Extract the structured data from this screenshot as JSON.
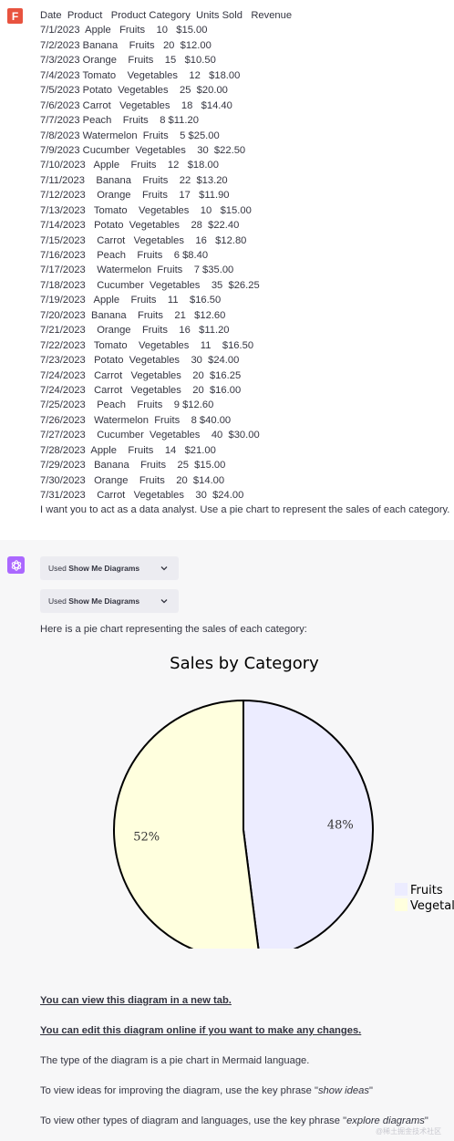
{
  "user": {
    "avatar_letter": "F",
    "avatar_color": "#e8533f",
    "lines": [
      "Date  Product   Product Category  Units Sold   Revenue",
      "7/1/2023  Apple   Fruits    10   $15.00",
      "7/2/2023 Banana    Fruits   20  $12.00",
      "7/3/2023 Orange    Fruits    15   $10.50",
      "7/4/2023 Tomato    Vegetables    12   $18.00",
      "7/5/2023 Potato  Vegetables    25  $20.00",
      "7/6/2023 Carrot   Vegetables    18   $14.40",
      "7/7/2023 Peach    Fruits    8 $11.20",
      "7/8/2023 Watermelon  Fruits    5 $25.00",
      "7/9/2023 Cucumber  Vegetables    30  $22.50",
      "7/10/2023   Apple    Fruits    12   $18.00",
      "7/11/2023    Banana    Fruits    22  $13.20",
      "7/12/2023    Orange    Fruits    17   $11.90",
      "7/13/2023   Tomato    Vegetables    10   $15.00",
      "7/14/2023   Potato  Vegetables    28  $22.40",
      "7/15/2023    Carrot   Vegetables    16   $12.80",
      "7/16/2023    Peach    Fruits    6 $8.40",
      "7/17/2023    Watermelon  Fruits    7 $35.00",
      "7/18/2023    Cucumber  Vegetables    35  $26.25",
      "7/19/2023   Apple    Fruits    11    $16.50",
      "7/20/2023  Banana    Fruits    21   $12.60",
      "7/21/2023    Orange    Fruits    16   $11.20",
      "7/22/2023   Tomato    Vegetables    11    $16.50",
      "7/23/2023   Potato  Vegetables    30  $24.00",
      "7/24/2023   Carrot   Vegetables    20  $16.25",
      "7/24/2023   Carrot   Vegetables    20  $16.00",
      "7/25/2023    Peach    Fruits    9 $12.60",
      "7/26/2023   Watermelon  Fruits    8 $40.00",
      "7/27/2023    Cucumber  Vegetables    40  $30.00",
      "7/28/2023  Apple    Fruits    14   $21.00",
      "7/29/2023   Banana    Fruits    25  $15.00",
      "7/30/2023   Orange    Fruits    20  $14.00",
      "7/31/2023    Carrot   Vegetables    30  $24.00"
    ],
    "prompt": "I want you to act as a data analyst. Use a pie chart to represent the sales of each category."
  },
  "assistant": {
    "avatar_color": "#ab68ff",
    "tool_pills": [
      {
        "prefix": "Used ",
        "tool": "Show Me Diagrams"
      },
      {
        "prefix": "Used ",
        "tool": "Show Me Diagrams"
      }
    ],
    "intro": "Here is a pie chart representing the sales of each category:",
    "link_new_tab": "You can view this diagram in a new tab.",
    "link_edit": "You can edit this diagram online if you want to make any changes.",
    "para_type": "The type of the diagram is a pie chart in Mermaid language.",
    "para_ideas_pre": "To view ideas for improving the diagram, use the key phrase \"",
    "para_ideas_key": "show ideas",
    "para_ideas_post": "\"",
    "para_explore_pre": "To view other types of diagram and languages, use the key phrase \"",
    "para_explore_key": "explore diagrams",
    "para_explore_post": "\"",
    "watermark": "@稀土掘金技术社区"
  },
  "chart_data": {
    "type": "pie",
    "title": "Sales by Category",
    "slices": [
      {
        "label": "Fruits",
        "value": 48,
        "display": "48%",
        "color": "#ececff"
      },
      {
        "label": "Vegetal",
        "value": 52,
        "display": "52%",
        "color": "#ffffde"
      }
    ],
    "legend_position": "right"
  }
}
